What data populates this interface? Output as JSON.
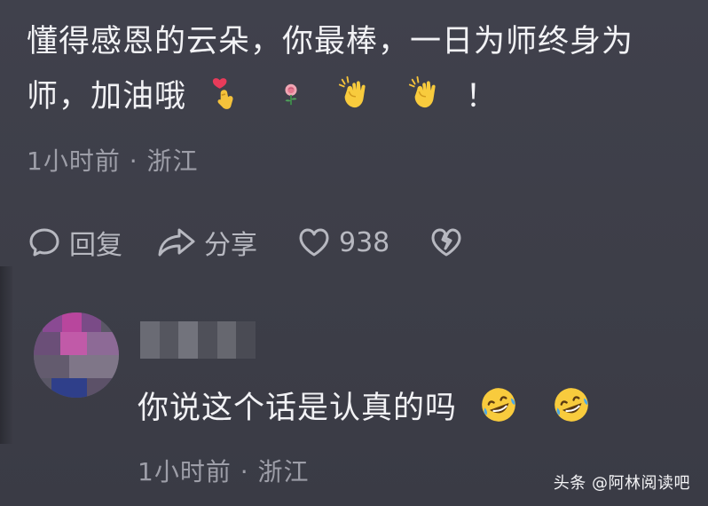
{
  "comment": {
    "line1": "懂得感恩的云朵，你最棒，一日为师终身为",
    "line2_text": "师，加油哦",
    "line2_end": "！",
    "emojis": [
      "kiss-finger-heart-icon",
      "rose-icon",
      "clapping-hands-icon",
      "clapping-hands-icon"
    ],
    "meta": "1小时前 · 浙江"
  },
  "actions": {
    "reply_label": "回复",
    "share_label": "分享",
    "like_count": "938"
  },
  "reply": {
    "text": "你说这个话是认真的吗",
    "emojis": [
      "rolling-laughing-icon",
      "rolling-laughing-icon"
    ],
    "meta": "1小时前 · 浙江"
  },
  "watermark": "头条 @阿林阅读吧",
  "colors": {
    "background": "#3e3f4a",
    "text": "#f2f2f5",
    "meta": "#9d9ea8",
    "action": "#b7b8c0"
  }
}
